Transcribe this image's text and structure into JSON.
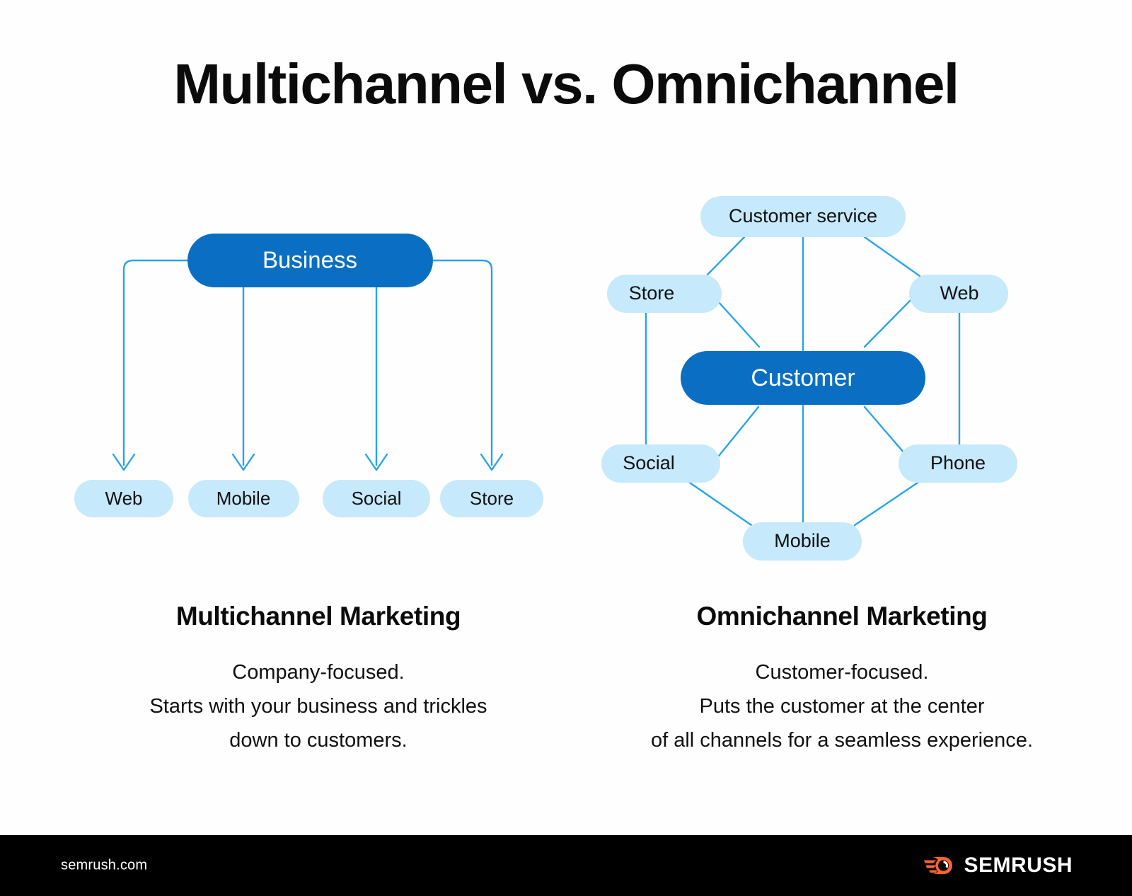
{
  "page": {
    "title": "Multichannel vs. Omnichannel",
    "background_color": "#fefefe"
  },
  "colors": {
    "dark_blue": "#0a6fc2",
    "light_blue": "#c6e9fc",
    "line_blue": "#29a3ea",
    "text_dark": "#111111",
    "text_light": "#ffffff",
    "footer_bg": "#000000",
    "logo_orange": "#ff642d"
  },
  "multichannel_diagram": {
    "root": {
      "label": "Business",
      "style": "dark"
    },
    "channels": [
      {
        "label": "Web",
        "style": "light"
      },
      {
        "label": "Mobile",
        "style": "light"
      },
      {
        "label": "Social",
        "style": "light"
      },
      {
        "label": "Store",
        "style": "light"
      }
    ]
  },
  "omnichannel_diagram": {
    "center": {
      "label": "Customer",
      "style": "dark"
    },
    "channels": [
      {
        "label": "Customer service",
        "style": "light",
        "position": "top"
      },
      {
        "label": "Store",
        "style": "light",
        "position": "left-upper"
      },
      {
        "label": "Web",
        "style": "light",
        "position": "right-upper"
      },
      {
        "label": "Social",
        "style": "light",
        "position": "left-lower"
      },
      {
        "label": "Phone",
        "style": "light",
        "position": "right-lower"
      },
      {
        "label": "Mobile",
        "style": "light",
        "position": "bottom"
      }
    ]
  },
  "captions": {
    "left": {
      "heading": "Multichannel Marketing",
      "line1": "Company-focused.",
      "line2": "Starts with your business and trickles",
      "line3": "down to customers."
    },
    "right": {
      "heading": "Omnichannel Marketing",
      "line1": "Customer-focused.",
      "line2": "Puts the customer at the center",
      "line3": "of all channels for a seamless experience."
    }
  },
  "footer": {
    "url": "semrush.com",
    "brand": "SEMRUSH",
    "logo_icon": "semrush-comet-icon"
  }
}
